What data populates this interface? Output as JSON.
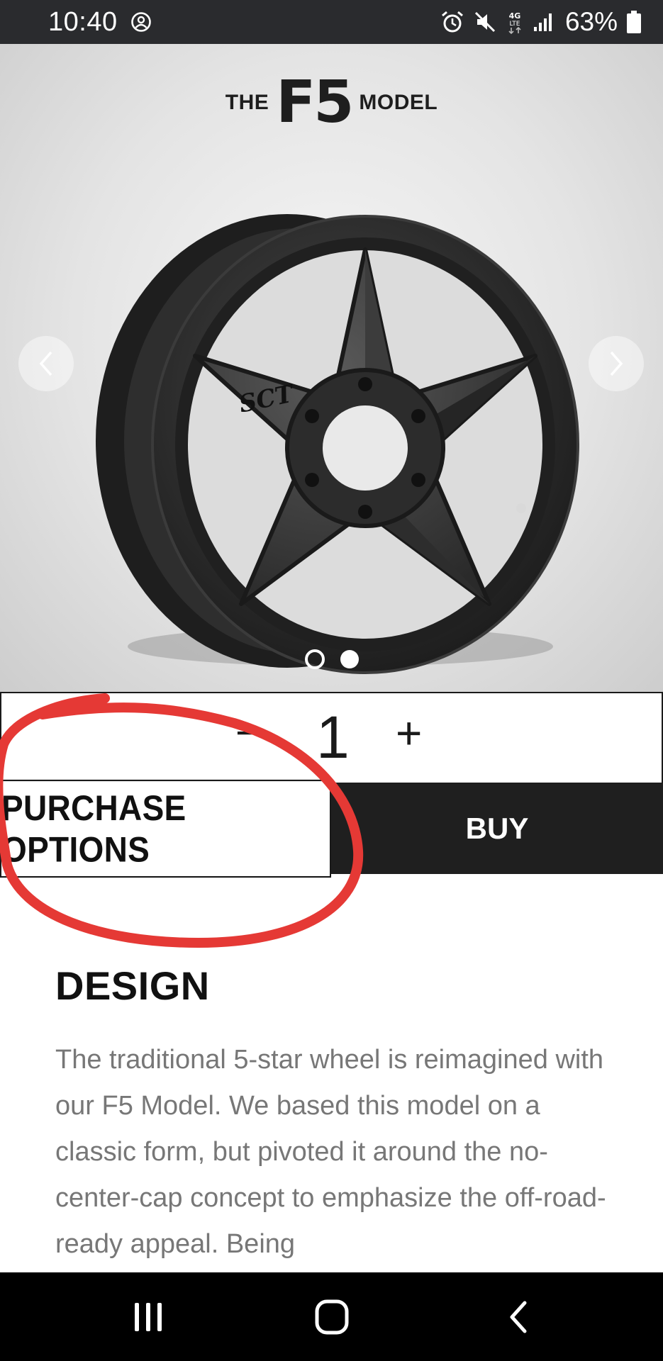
{
  "status_bar": {
    "time": "10:40",
    "battery": "63%",
    "icons": [
      "account-circle-icon",
      "alarm-icon",
      "mute-icon",
      "lte-data-icon",
      "signal-icon",
      "battery-icon"
    ]
  },
  "product": {
    "title_prefix": "THE",
    "title_main": "F5",
    "title_suffix": "MODEL",
    "image": "black-5-spoke-wheel",
    "carousel": {
      "slides": 2,
      "active_slide": 1
    }
  },
  "quantity": {
    "minus_label": "−",
    "value": "1",
    "plus_label": "+"
  },
  "actions": {
    "purchase_options_label": "PURCHASE OPTIONS",
    "buy_label": "BUY"
  },
  "annotation": {
    "color": "#e53935"
  },
  "design": {
    "heading": "DESIGN",
    "body": "The traditional 5-star wheel is reimagined with our F5 Model. We based this model on a classic form, but pivoted it around the no-center-cap concept to emphasize the off-road-ready appeal. Being"
  },
  "colors": {
    "status_bar": "#2a2b2e",
    "buy_button": "#1f1f1f",
    "body_text": "#777777",
    "annotation": "#e53935"
  }
}
